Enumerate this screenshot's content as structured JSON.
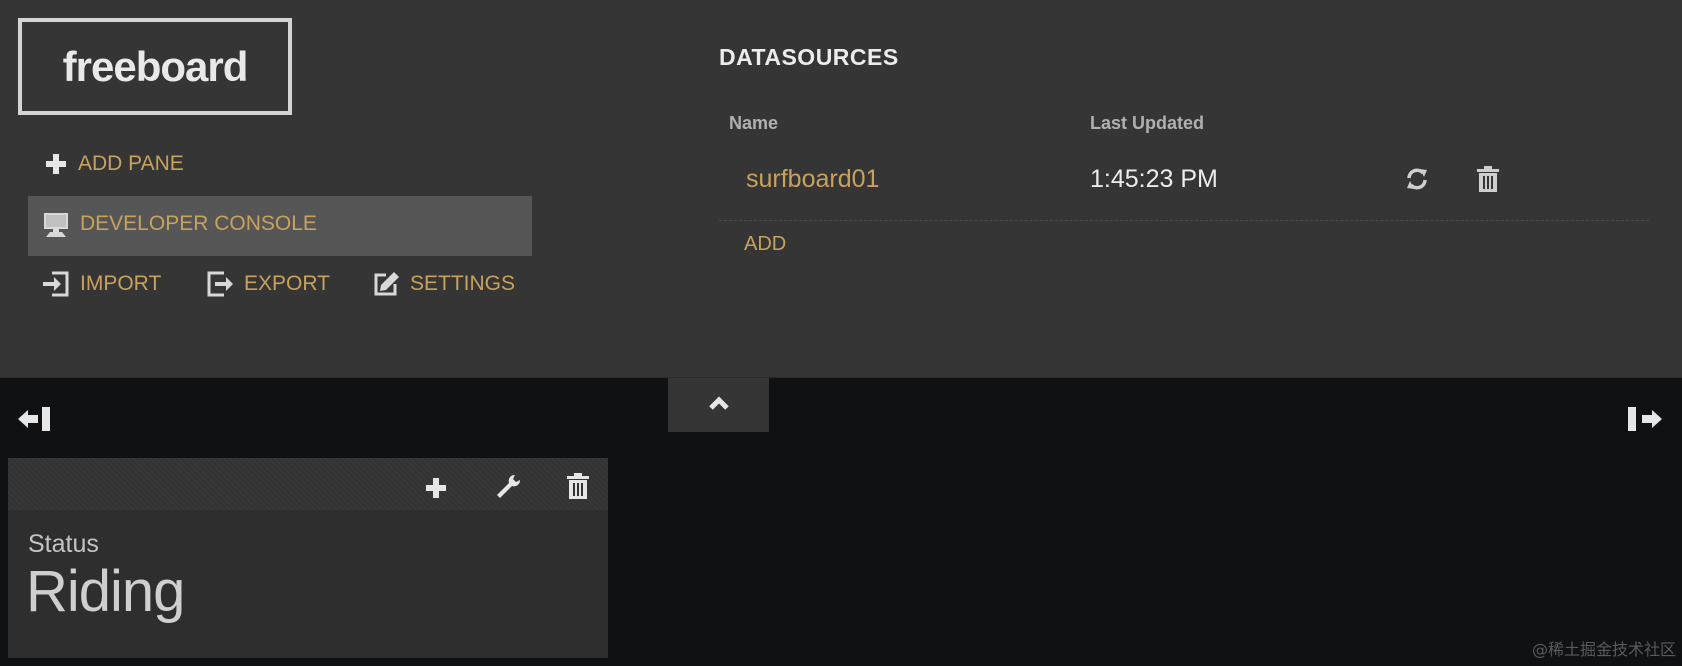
{
  "app": {
    "logo_text": "freeboard"
  },
  "menu": {
    "add_pane": "ADD PANE",
    "developer_console": "DEVELOPER CONSOLE",
    "import": "IMPORT",
    "export": "EXPORT",
    "settings": "SETTINGS"
  },
  "datasources": {
    "title": "DATASOURCES",
    "col_name": "Name",
    "col_last_updated": "Last Updated",
    "rows": [
      {
        "name": "surfboard01",
        "last_updated": "1:45:23 PM"
      }
    ],
    "add_label": "ADD"
  },
  "pane": {
    "widget_label": "Status",
    "widget_value": "Riding"
  },
  "watermark": "@稀土掘金技术社区",
  "colors": {
    "accent": "#c8a25d",
    "header_bg": "#353535",
    "board_bg": "#101113",
    "pane_bg": "#2e2e2e"
  },
  "icons": {
    "add_pane": "plus-icon",
    "developer_console": "monitor-icon",
    "import": "import-icon",
    "export": "export-icon",
    "settings": "edit-icon",
    "refresh": "refresh-icon",
    "delete": "trash-icon",
    "collapse": "chevron-up-icon",
    "shrink": "arrow-left-bar-icon",
    "expand": "arrow-right-bar-icon",
    "wrench": "wrench-icon"
  }
}
